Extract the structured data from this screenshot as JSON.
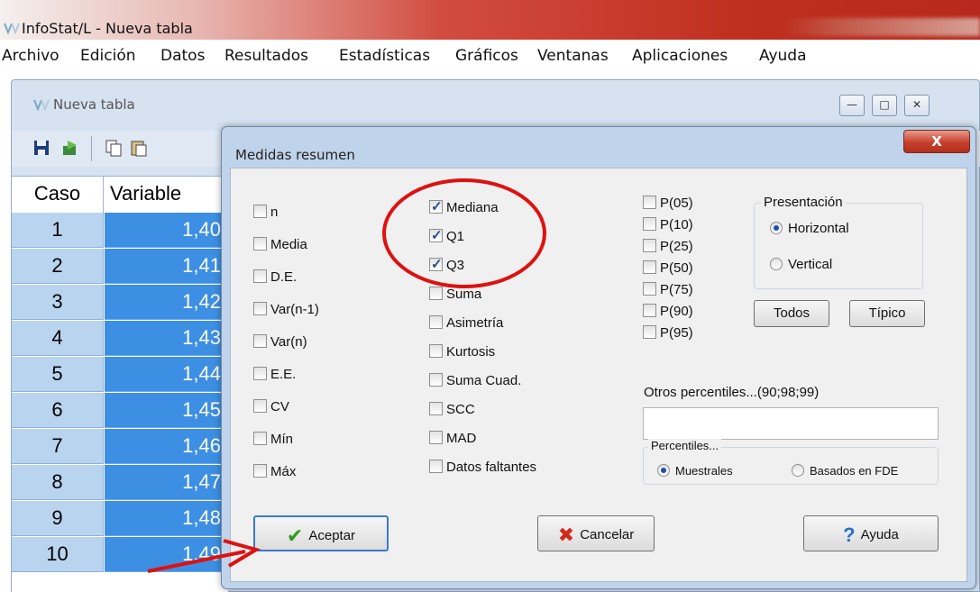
{
  "app": {
    "title": "InfoStat/L - Nueva tabla"
  },
  "menu": [
    "Archivo",
    "Edición",
    "Datos",
    "Resultados",
    "Estadísticas",
    "Gráficos",
    "Ventanas",
    "Aplicaciones",
    "Ayuda"
  ],
  "child_window": {
    "title": "Nueva tabla",
    "controls": {
      "minimize": "—",
      "maximize": "□",
      "close": "✕"
    }
  },
  "grid": {
    "headers": [
      "Caso",
      "Variable"
    ],
    "rows": [
      [
        "1",
        "1,40"
      ],
      [
        "2",
        "1,41"
      ],
      [
        "3",
        "1,42"
      ],
      [
        "4",
        "1,43"
      ],
      [
        "5",
        "1,44"
      ],
      [
        "6",
        "1,45"
      ],
      [
        "7",
        "1,46"
      ],
      [
        "8",
        "1,47"
      ],
      [
        "9",
        "1,48"
      ],
      [
        "10",
        "1,49"
      ]
    ]
  },
  "dialog": {
    "title": "Medidas resumen",
    "close_label": "X",
    "col1": [
      {
        "label": "n",
        "checked": false
      },
      {
        "label": "Media",
        "checked": false
      },
      {
        "label": "D.E.",
        "checked": false
      },
      {
        "label": "Var(n-1)",
        "checked": false
      },
      {
        "label": "Var(n)",
        "checked": false
      },
      {
        "label": "E.E.",
        "checked": false
      },
      {
        "label": "CV",
        "checked": false
      },
      {
        "label": "Mín",
        "checked": false
      },
      {
        "label": "Máx",
        "checked": false
      }
    ],
    "col2": [
      {
        "label": "Mediana",
        "checked": true
      },
      {
        "label": "Q1",
        "checked": true
      },
      {
        "label": "Q3",
        "checked": true
      },
      {
        "label": "Suma",
        "checked": false
      },
      {
        "label": "Asimetría",
        "checked": false
      },
      {
        "label": "Kurtosis",
        "checked": false
      },
      {
        "label": "Suma Cuad.",
        "checked": false
      },
      {
        "label": "SCC",
        "checked": false
      },
      {
        "label": "MAD",
        "checked": false
      },
      {
        "label": "Datos faltantes",
        "checked": false
      }
    ],
    "col3": [
      {
        "label": "P(05)",
        "checked": false
      },
      {
        "label": "P(10)",
        "checked": false
      },
      {
        "label": "P(25)",
        "checked": false
      },
      {
        "label": "P(50)",
        "checked": false
      },
      {
        "label": "P(75)",
        "checked": false
      },
      {
        "label": "P(90)",
        "checked": false
      },
      {
        "label": "P(95)",
        "checked": false
      }
    ],
    "presentacion": {
      "label": "Presentación",
      "options": [
        "Horizontal",
        "Vertical"
      ],
      "selected": "Horizontal"
    },
    "todos_label": "Todos",
    "tipico_label": "Típico",
    "otros_label": "Otros percentiles...(90;98;99)",
    "otros_value": "",
    "percentiles": {
      "label": "Percentiles...",
      "options": [
        "Muestrales",
        "Basados en FDE"
      ],
      "selected": "Muestrales"
    },
    "aceptar_label": "Aceptar",
    "cancelar_label": "Cancelar",
    "ayuda_label": "Ayuda"
  },
  "annotation_color": "#e01010"
}
